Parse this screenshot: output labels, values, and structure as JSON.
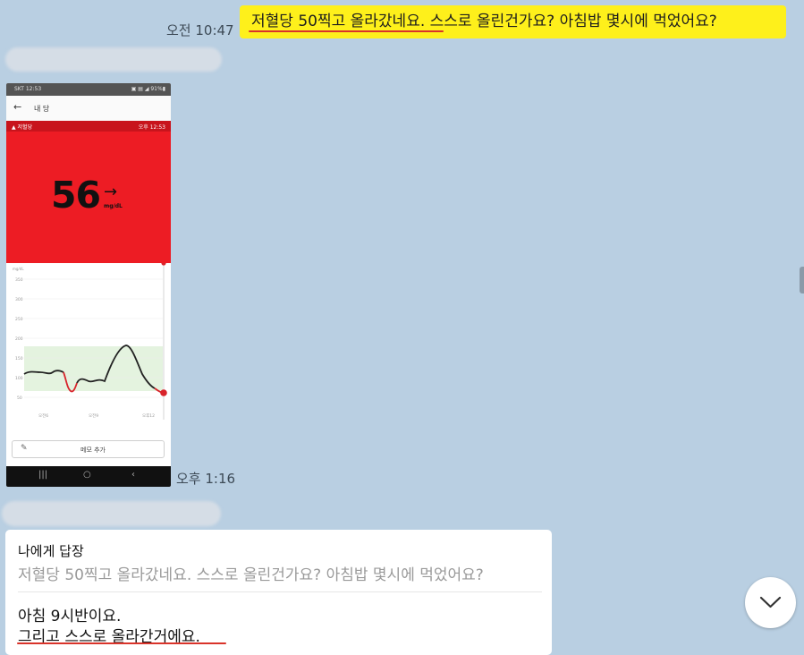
{
  "outgoing": {
    "time": "오전 10:47",
    "text": "저혈당 50찍고 올라갔네요. 스스로 올린건가요? 아침밥 몇시에 먹었어요?"
  },
  "image_message": {
    "time": "오후 1:16",
    "screenshot": {
      "status_left": "SKT 12:53",
      "status_right": "▣ ▤ ◢ 91%▮",
      "title": "내 당",
      "alert_label": "저혈당",
      "alert_time": "오후 12:53",
      "glucose_value": "56",
      "glucose_unit": "mg/dL",
      "memo_button": "메모 추가",
      "chart_unit": "mg/dL",
      "y_ticks": [
        "350",
        "300",
        "250",
        "200",
        "150",
        "100",
        "50"
      ],
      "x_ticks": [
        "오전6",
        "오전9",
        "오후12"
      ]
    }
  },
  "reply": {
    "title": "나에게 답장",
    "quoted": "저혈당 50찍고 올라갔네요. 스스로 올린건가요? 아침밥 몇시에 먹었어요?",
    "line1": "아침 9시반이요.",
    "line2": "그리고 스스로 올라간거에요."
  },
  "colors": {
    "chat_bg": "#b9cfe2",
    "my_bubble": "#fef01b",
    "alert_red": "#ed1c24",
    "underline": "#d9332a"
  },
  "icons": {
    "scroll_down": "chevron-down-icon",
    "back": "arrow-left-icon",
    "pen": "pencil-icon"
  }
}
